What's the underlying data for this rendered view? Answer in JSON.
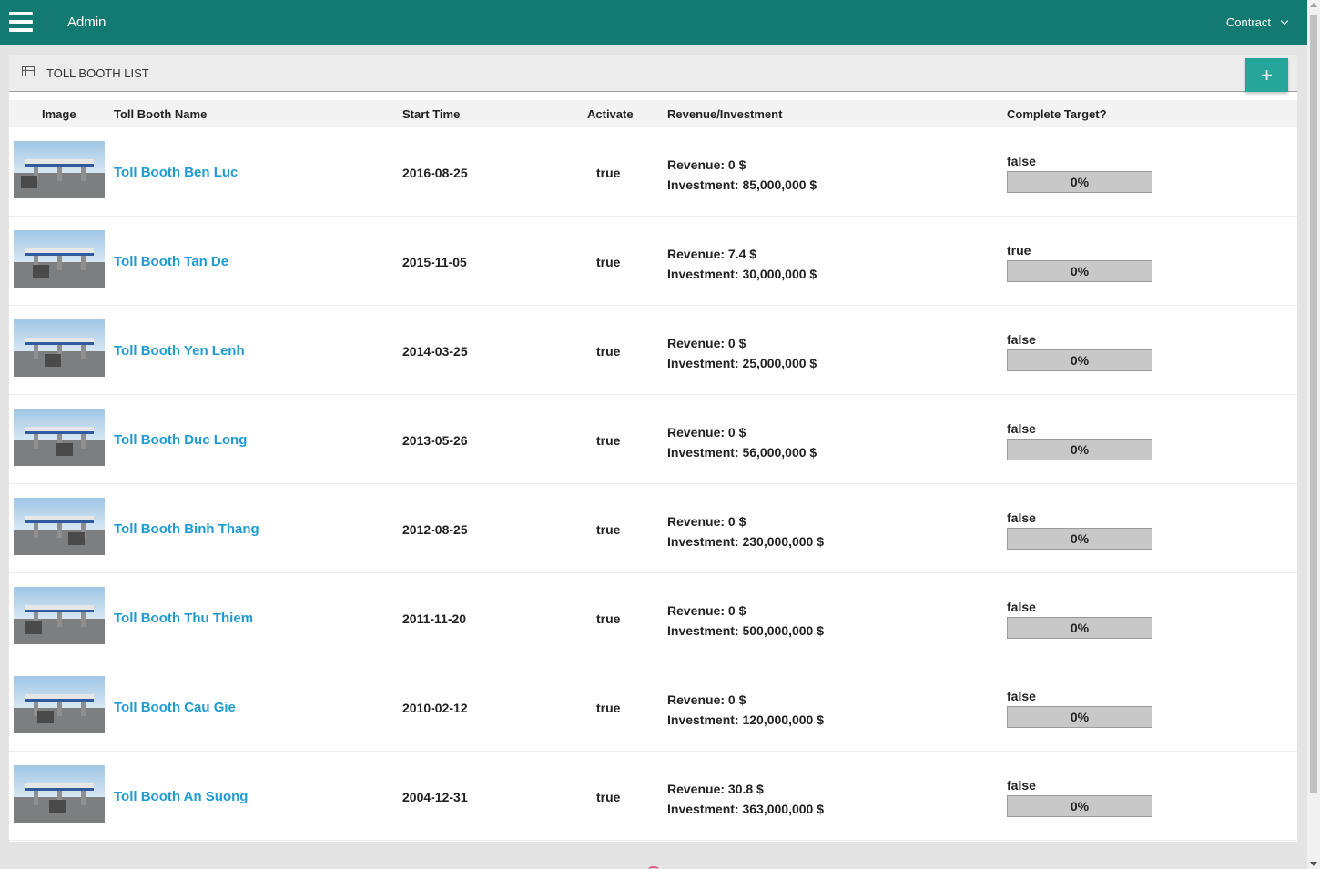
{
  "header": {
    "title": "Admin",
    "user_menu": "Contract"
  },
  "card": {
    "title": "TOLL BOOTH LIST",
    "add_label": "+"
  },
  "table": {
    "columns": [
      "Image",
      "Toll Booth Name",
      "Start Time",
      "Activate",
      "Revenue/Investment",
      "Complete Target?"
    ],
    "rows": [
      {
        "name": "Toll Booth Ben Luc",
        "start": "2016-08-25",
        "activate": "true",
        "revenue": "Revenue: 0 $",
        "investment": "Investment: 85,000,000 $",
        "target": "false",
        "progress_label": "0%",
        "progress": 0
      },
      {
        "name": "Toll Booth Tan De",
        "start": "2015-11-05",
        "activate": "true",
        "revenue": "Revenue: 7.4 $",
        "investment": "Investment: 30,000,000 $",
        "target": "true",
        "progress_label": "0%",
        "progress": 0
      },
      {
        "name": "Toll Booth Yen Lenh",
        "start": "2014-03-25",
        "activate": "true",
        "revenue": "Revenue: 0 $",
        "investment": "Investment: 25,000,000 $",
        "target": "false",
        "progress_label": "0%",
        "progress": 0
      },
      {
        "name": "Toll Booth Duc Long",
        "start": "2013-05-26",
        "activate": "true",
        "revenue": "Revenue: 0 $",
        "investment": "Investment: 56,000,000 $",
        "target": "false",
        "progress_label": "0%",
        "progress": 0
      },
      {
        "name": "Toll Booth Binh Thang",
        "start": "2012-08-25",
        "activate": "true",
        "revenue": "Revenue: 0 $",
        "investment": "Investment: 230,000,000 $",
        "target": "false",
        "progress_label": "0%",
        "progress": 0
      },
      {
        "name": "Toll Booth Thu Thiem",
        "start": "2011-11-20",
        "activate": "true",
        "revenue": "Revenue: 0 $",
        "investment": "Investment: 500,000,000 $",
        "target": "false",
        "progress_label": "0%",
        "progress": 0
      },
      {
        "name": "Toll Booth Cau Gie",
        "start": "2010-02-12",
        "activate": "true",
        "revenue": "Revenue: 0 $",
        "investment": "Investment: 120,000,000 $",
        "target": "false",
        "progress_label": "0%",
        "progress": 0
      },
      {
        "name": "Toll Booth An Suong",
        "start": "2004-12-31",
        "activate": "true",
        "revenue": "Revenue: 30.8 $",
        "investment": "Investment: 363,000,000 $",
        "target": "false",
        "progress_label": "0%",
        "progress": 0
      }
    ]
  },
  "colors": {
    "header": "#127a70",
    "accent": "#26a69a",
    "link": "#1f9bd1"
  }
}
